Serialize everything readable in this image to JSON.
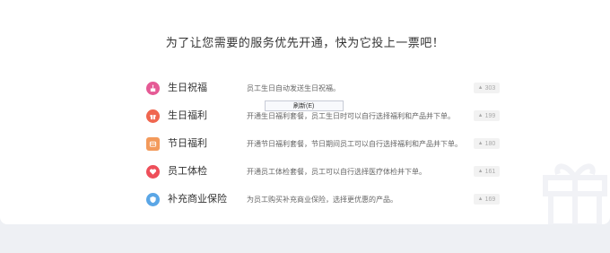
{
  "heading": "为了让您需要的服务优先开通，快为它投上一票吧！",
  "tooltip": "刷新(E)",
  "colors": {
    "birthday": "#e55a95",
    "benefit": "#f0664f",
    "holiday": "#f39a5b",
    "checkup": "#ee4f5a",
    "insurance": "#5aa6e6"
  },
  "services": [
    {
      "icon": "birthday-cake-icon",
      "name": "生日祝福",
      "desc": "员工生日自动发送生日祝福。",
      "votes": "303"
    },
    {
      "icon": "gift-icon",
      "name": "生日福利",
      "desc": "开通生日福利套餐，员工生日时可以自行选择福利和产品并下单。",
      "votes": "199"
    },
    {
      "icon": "holiday-package-icon",
      "name": "节日福利",
      "desc": "开通节日福利套餐，节日期间员工可以自行选择福利和产品并下单。",
      "votes": "180"
    },
    {
      "icon": "heart-health-icon",
      "name": "员工体检",
      "desc": "开通员工体检套餐，员工可以自行选择医疗体检并下单。",
      "votes": "161"
    },
    {
      "icon": "shield-insurance-icon",
      "name": "补充商业保险",
      "desc": "为员工购买补充商业保险，选择更优惠的产品。",
      "votes": "169"
    }
  ],
  "vote_arrow": "▲"
}
